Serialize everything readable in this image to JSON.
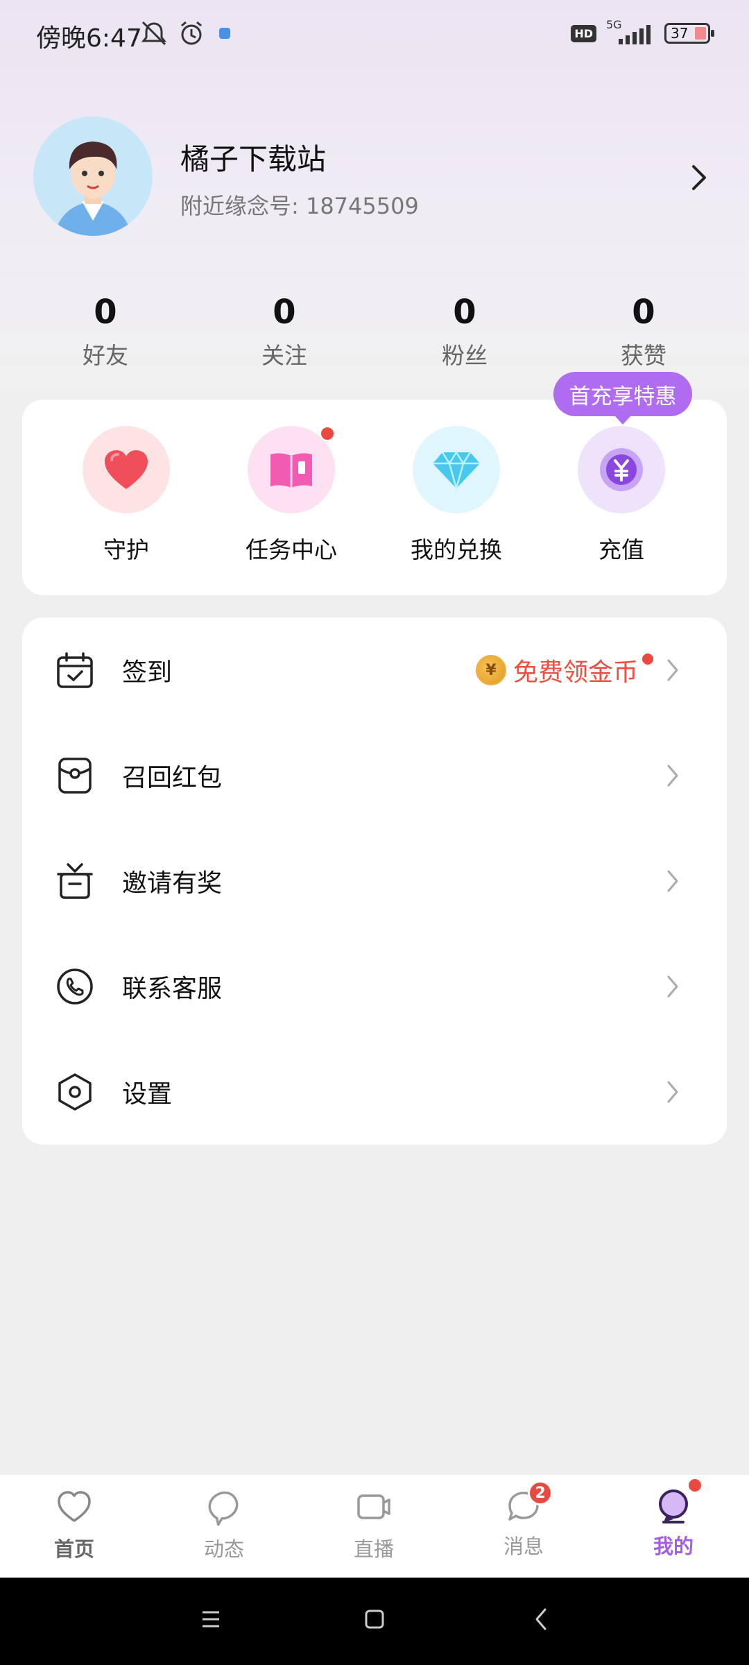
{
  "status_bar": {
    "time": "傍晚6:47",
    "network": "5G",
    "hd": "HD",
    "battery": "37"
  },
  "profile": {
    "name": "橘子下载站",
    "id_line": "附近缘念号: 18745509"
  },
  "stats": [
    {
      "value": "0",
      "label": "好友"
    },
    {
      "value": "0",
      "label": "关注"
    },
    {
      "value": "0",
      "label": "粉丝"
    },
    {
      "value": "0",
      "label": "获赞"
    }
  ],
  "quick_actions": {
    "promo_bubble": "首充享特惠",
    "items": [
      {
        "label": "守护",
        "icon": "heart-icon"
      },
      {
        "label": "任务中心",
        "icon": "book-icon"
      },
      {
        "label": "我的兑换",
        "icon": "diamond-icon"
      },
      {
        "label": "充值",
        "icon": "yuan-coin-icon"
      }
    ]
  },
  "menu": {
    "items": [
      {
        "label": "签到",
        "icon": "calendar-check-icon",
        "extra": "免费领金币"
      },
      {
        "label": "召回红包",
        "icon": "red-packet-icon"
      },
      {
        "label": "邀请有奖",
        "icon": "gift-box-icon"
      },
      {
        "label": "联系客服",
        "icon": "phone-icon"
      },
      {
        "label": "设置",
        "icon": "settings-hexagon-icon"
      }
    ]
  },
  "coin_symbol": "¥",
  "tabbar": {
    "tabs": [
      {
        "label": "首页",
        "icon": "heart-outline-icon"
      },
      {
        "label": "动态",
        "icon": "chat-bubble-icon"
      },
      {
        "label": "直播",
        "icon": "video-camera-icon"
      },
      {
        "label": "消息",
        "icon": "message-icon",
        "badge": "2"
      },
      {
        "label": "我的",
        "icon": "profile-bubble-icon"
      }
    ],
    "active_tab": "我的"
  },
  "colors": {
    "accent": "#a45de6",
    "promo": "#b06cf0",
    "alert": "#ef4f3f"
  }
}
